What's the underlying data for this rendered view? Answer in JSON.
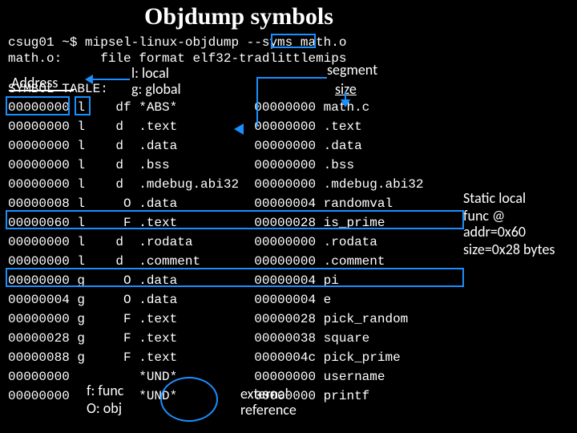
{
  "title": "Objdump symbols",
  "cmd": "csug01 ~$ mipsel-linux-objdump --syms math.o",
  "fmt": "math.o:     file format elf32-tradlittlemips",
  "ann": {
    "address": "Address",
    "llocal": "l: local",
    "gglobal": "g: global",
    "segment": "segment",
    "size": "size",
    "func": "f: func",
    "obj": "O: obj",
    "ext1": "external",
    "ext2": "reference",
    "static": "Static local",
    "func2": "func @",
    "addr": "addr=0x60",
    "size2": "size=0x28 bytes"
  },
  "symtitle": "SYMBOL TABLE:",
  "rows": [
    "00000000 l    df *ABS*          00000000 math.c",
    "00000000 l    d  .text          00000000 .text",
    "00000000 l    d  .data          00000000 .data",
    "00000000 l    d  .bss           00000000 .bss",
    "00000000 l    d  .mdebug.abi32  00000000 .mdebug.abi32",
    "00000008 l     O .data          00000004 randomval",
    "00000060 l     F .text          00000028 is_prime",
    "00000000 l    d  .rodata        00000000 .rodata",
    "00000000 l    d  .comment       00000000 .comment",
    "00000000 g     O .data          00000004 pi",
    "00000004 g     O .data          00000004 e",
    "00000000 g     F .text          00000028 pick_random",
    "00000028 g     F .text          00000038 square",
    "00000088 g     F .text          0000004c pick_prime",
    "00000000         *UND*          00000000 username",
    "00000000         *UND*          00000000 printf"
  ]
}
